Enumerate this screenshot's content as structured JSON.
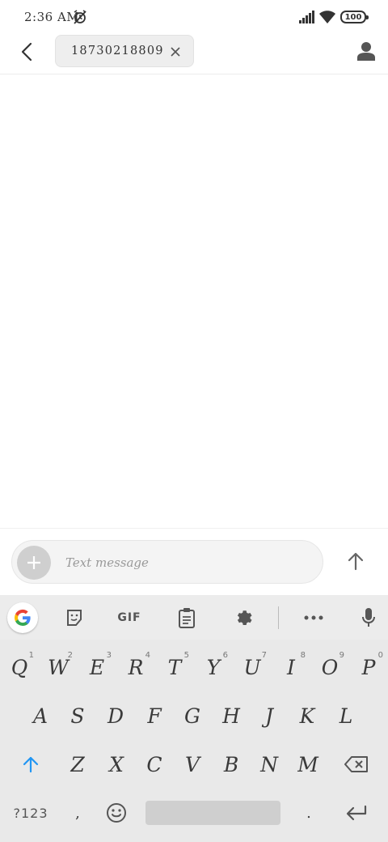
{
  "status_bar": {
    "time": "2:36 AM",
    "battery": "100"
  },
  "header": {
    "recipient": "18730218809"
  },
  "compose": {
    "placeholder": "Text message"
  },
  "keyboard": {
    "toolbar": {
      "gif_label": "GIF"
    },
    "row1": [
      {
        "label": "Q",
        "hint": "1"
      },
      {
        "label": "W",
        "hint": "2"
      },
      {
        "label": "E",
        "hint": "3"
      },
      {
        "label": "R",
        "hint": "4"
      },
      {
        "label": "T",
        "hint": "5"
      },
      {
        "label": "Y",
        "hint": "6"
      },
      {
        "label": "U",
        "hint": "7"
      },
      {
        "label": "I",
        "hint": "8"
      },
      {
        "label": "O",
        "hint": "9"
      },
      {
        "label": "P",
        "hint": "0"
      }
    ],
    "row2": [
      "A",
      "S",
      "D",
      "F",
      "G",
      "H",
      "J",
      "K",
      "L"
    ],
    "row3": [
      "Z",
      "X",
      "C",
      "V",
      "B",
      "N",
      "M"
    ],
    "bottom": {
      "symbols_label": "?123",
      "comma": ",",
      "period": "."
    }
  }
}
